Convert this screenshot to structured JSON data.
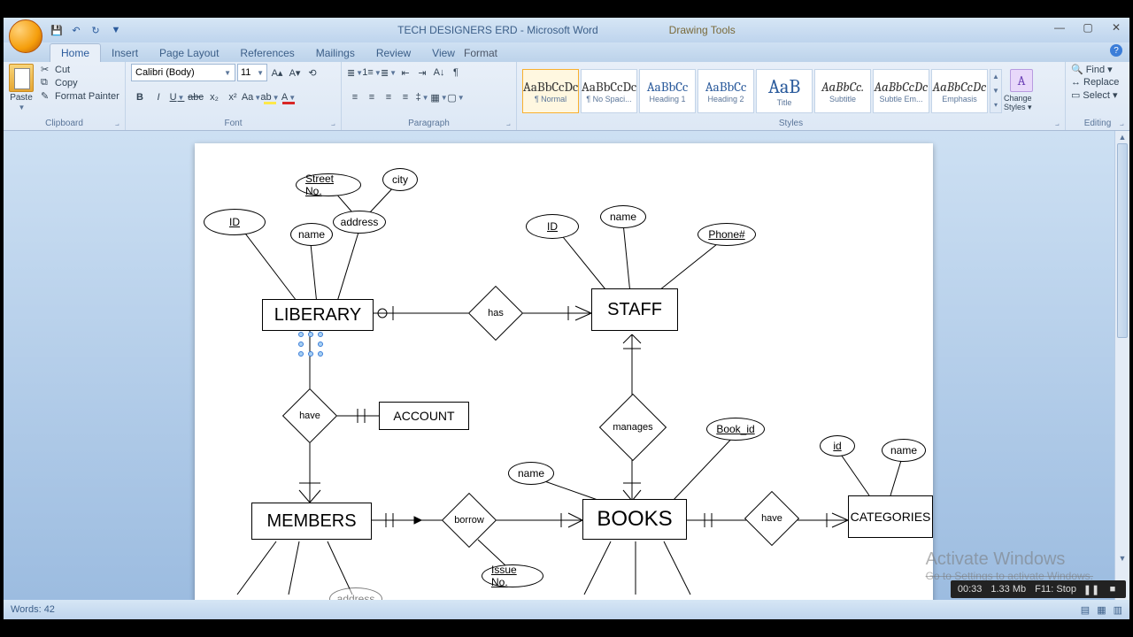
{
  "title": {
    "doc": "TECH DESIGNERS ERD - Microsoft Word",
    "context": "Drawing Tools"
  },
  "tabs": {
    "home": "Home",
    "insert": "Insert",
    "pageLayout": "Page Layout",
    "references": "References",
    "mailings": "Mailings",
    "review": "Review",
    "view": "View",
    "format": "Format"
  },
  "clipboard": {
    "paste": "Paste",
    "cut": "Cut",
    "copy": "Copy",
    "formatPainter": "Format Painter",
    "label": "Clipboard"
  },
  "font": {
    "name": "Calibri (Body)",
    "size": "11",
    "label": "Font"
  },
  "paragraph": {
    "label": "Paragraph"
  },
  "styles": {
    "label": "Styles",
    "changeStyles": "Change Styles ▾",
    "tiles": [
      {
        "preview": "AaBbCcDc",
        "name": "¶ Normal"
      },
      {
        "preview": "AaBbCcDc",
        "name": "¶ No Spaci..."
      },
      {
        "preview": "AaBbCc",
        "name": "Heading 1"
      },
      {
        "preview": "AaBbCc",
        "name": "Heading 2"
      },
      {
        "preview": "AaB",
        "name": "Title"
      },
      {
        "preview": "AaBbCc.",
        "name": "Subtitle"
      },
      {
        "preview": "AaBbCcDc",
        "name": "Subtle Em..."
      },
      {
        "preview": "AaBbCcDc",
        "name": "Emphasis"
      }
    ]
  },
  "editing": {
    "find": "Find ▾",
    "replace": "Replace",
    "select": "Select ▾",
    "label": "Editing"
  },
  "erd": {
    "liberary": "LIBERARY",
    "staff": "STAFF",
    "account": "ACCOUNT",
    "members": "MEMBERS",
    "books": "BOOKS",
    "categories": "CATEGORIES",
    "has": "has",
    "have": "have",
    "have2": "have",
    "manages": "manages",
    "borrow": "borrow",
    "id1": "ID",
    "streetNo": "Street No.",
    "city": "city",
    "name1": "name",
    "address1": "address",
    "id2": "ID",
    "name2": "name",
    "phone": "Phone#",
    "name3": "name",
    "bookId": "Book_id",
    "issueNo": "Issue No.",
    "id3": "id",
    "name4": "name",
    "address2": "address"
  },
  "watermark": {
    "title": "Activate Windows",
    "sub": "Go to Settings to activate Windows."
  },
  "status": {
    "words": "Words: 42"
  },
  "rec": {
    "time": "00:33",
    "size": "1.33 Mb",
    "stop": "F11: Stop"
  }
}
